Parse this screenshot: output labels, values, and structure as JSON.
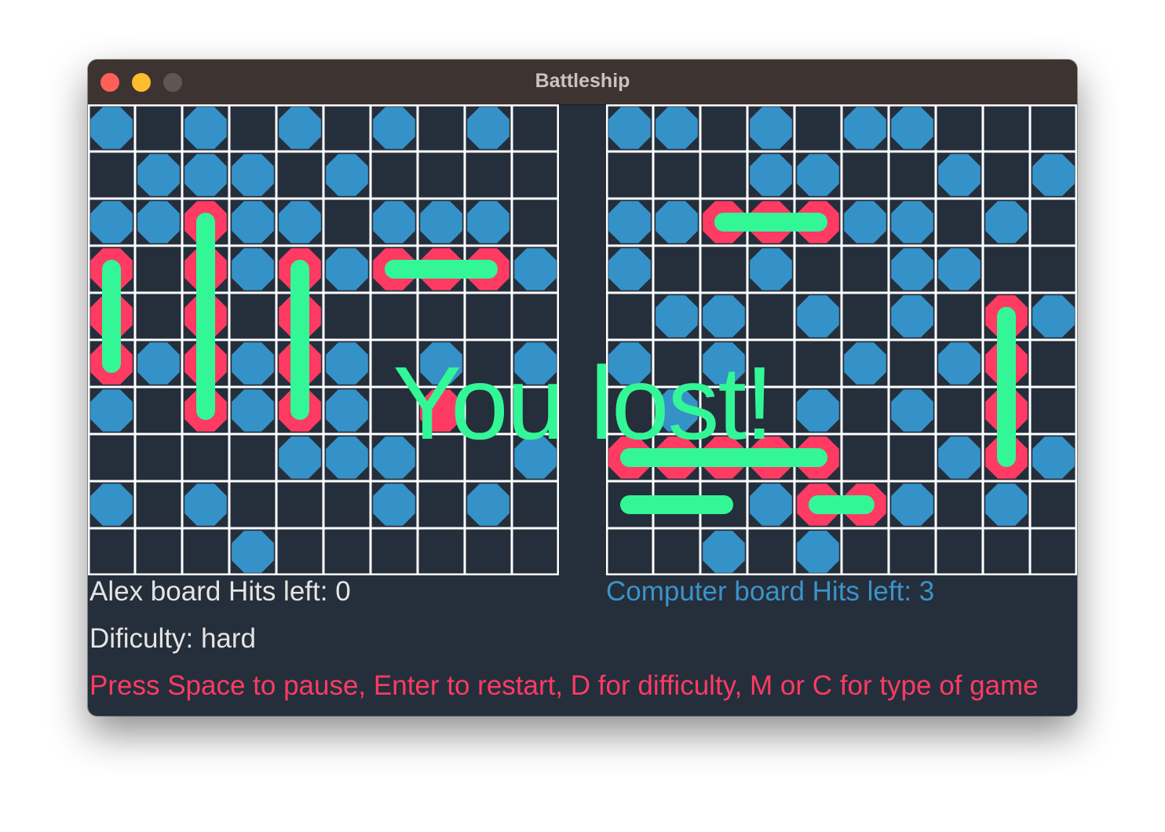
{
  "window": {
    "title": "Battleship"
  },
  "colors": {
    "background": "#252e3b",
    "grid": "#ffffff",
    "miss": "#3592c8",
    "hit": "#ff3b64",
    "ship": "#33f797",
    "help": "#ff3b64",
    "computer_label": "#3b93c9"
  },
  "game": {
    "overlay_message": "You lost!",
    "difficulty_text": "Dificulty: hard",
    "help_text": "Press Space to pause, Enter to restart, D for difficulty, M or C for type of game"
  },
  "boards": [
    {
      "id": "alex",
      "label": "Alex board  Hits left: 0",
      "misses": [
        [
          0,
          0
        ],
        [
          2,
          0
        ],
        [
          4,
          0
        ],
        [
          6,
          0
        ],
        [
          8,
          0
        ],
        [
          1,
          1
        ],
        [
          2,
          1
        ],
        [
          3,
          1
        ],
        [
          5,
          1
        ],
        [
          0,
          2
        ],
        [
          1,
          2
        ],
        [
          3,
          2
        ],
        [
          4,
          2
        ],
        [
          6,
          2
        ],
        [
          7,
          2
        ],
        [
          8,
          2
        ],
        [
          3,
          3
        ],
        [
          5,
          3
        ],
        [
          9,
          3
        ],
        [
          1,
          5
        ],
        [
          3,
          5
        ],
        [
          5,
          5
        ],
        [
          7,
          5
        ],
        [
          9,
          5
        ],
        [
          0,
          6
        ],
        [
          3,
          6
        ],
        [
          5,
          6
        ],
        [
          4,
          7
        ],
        [
          5,
          7
        ],
        [
          6,
          7
        ],
        [
          9,
          7
        ],
        [
          0,
          8
        ],
        [
          2,
          8
        ],
        [
          6,
          8
        ],
        [
          8,
          8
        ],
        [
          3,
          9
        ]
      ],
      "hits": [
        [
          0,
          3
        ],
        [
          0,
          4
        ],
        [
          0,
          5
        ],
        [
          2,
          2
        ],
        [
          2,
          3
        ],
        [
          2,
          4
        ],
        [
          2,
          5
        ],
        [
          2,
          6
        ],
        [
          4,
          3
        ],
        [
          4,
          4
        ],
        [
          4,
          5
        ],
        [
          4,
          6
        ],
        [
          6,
          3
        ],
        [
          7,
          3
        ],
        [
          8,
          3
        ],
        [
          7,
          6
        ]
      ],
      "ships": [
        [
          0,
          3,
          0,
          5
        ],
        [
          2,
          2,
          2,
          6
        ],
        [
          4,
          3,
          4,
          6
        ],
        [
          6,
          3,
          8,
          3
        ]
      ]
    },
    {
      "id": "computer",
      "label": "Computer board  Hits left: 3",
      "misses": [
        [
          0,
          0
        ],
        [
          1,
          0
        ],
        [
          3,
          0
        ],
        [
          5,
          0
        ],
        [
          6,
          0
        ],
        [
          3,
          1
        ],
        [
          4,
          1
        ],
        [
          7,
          1
        ],
        [
          9,
          1
        ],
        [
          0,
          2
        ],
        [
          1,
          2
        ],
        [
          5,
          2
        ],
        [
          6,
          2
        ],
        [
          8,
          2
        ],
        [
          0,
          3
        ],
        [
          3,
          3
        ],
        [
          6,
          3
        ],
        [
          7,
          3
        ],
        [
          1,
          4
        ],
        [
          2,
          4
        ],
        [
          4,
          4
        ],
        [
          6,
          4
        ],
        [
          9,
          4
        ],
        [
          0,
          5
        ],
        [
          2,
          5
        ],
        [
          5,
          5
        ],
        [
          7,
          5
        ],
        [
          1,
          6
        ],
        [
          4,
          6
        ],
        [
          6,
          6
        ],
        [
          7,
          7
        ],
        [
          9,
          7
        ],
        [
          3,
          8
        ],
        [
          6,
          8
        ],
        [
          8,
          8
        ],
        [
          2,
          9
        ],
        [
          4,
          9
        ]
      ],
      "hits": [
        [
          2,
          2
        ],
        [
          3,
          2
        ],
        [
          4,
          2
        ],
        [
          8,
          4
        ],
        [
          8,
          5
        ],
        [
          8,
          6
        ],
        [
          8,
          7
        ],
        [
          0,
          7
        ],
        [
          1,
          7
        ],
        [
          2,
          7
        ],
        [
          3,
          7
        ],
        [
          4,
          7
        ],
        [
          4,
          8
        ],
        [
          5,
          8
        ]
      ],
      "ships": [
        [
          2,
          2,
          4,
          2
        ],
        [
          8,
          4,
          8,
          7
        ],
        [
          0,
          7,
          4,
          7
        ],
        [
          0,
          8,
          2,
          8
        ],
        [
          4,
          8,
          5,
          8
        ]
      ]
    }
  ]
}
